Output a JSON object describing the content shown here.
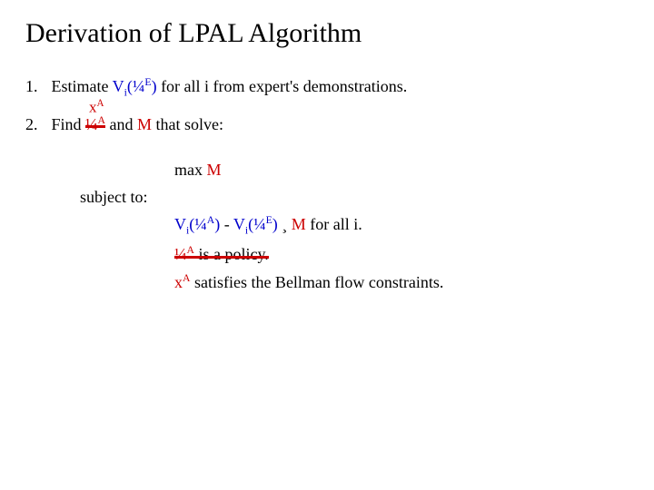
{
  "title": "Derivation of LPAL Algorithm",
  "step1": {
    "num": "1.",
    "pre": "Estimate ",
    "V": "V",
    "i": "i",
    "lp": "(",
    "pi": "¼",
    "E": "E",
    "rp": ")",
    "post": " for all i from expert's demonstrations."
  },
  "step2": {
    "num": "2.",
    "pre": "Find ",
    "piA_pi": "¼",
    "piA_A": "A",
    "and": " and ",
    "M": "M",
    "post": " that solve:",
    "xA_x": "x",
    "xA_A": "A"
  },
  "obj": {
    "max": "max ",
    "M": "M"
  },
  "subj": "subject to:",
  "c1": {
    "V1": "V",
    "i1": "i",
    "lp1": "(",
    "piA_pi": "¼",
    "piA_A": "A",
    "rp1": ")",
    "minus": " - ",
    "V2": "V",
    "i2": "i",
    "lp2": "(",
    "piE_pi": "¼",
    "piE_E": "E",
    "rp2": ")",
    "geq": " ¸ ",
    "M": "M",
    "forall": " for all i."
  },
  "c2": {
    "piA_pi": "¼",
    "piA_A": "A",
    "rest": " is a policy."
  },
  "c3": {
    "xA_x": "x",
    "xA_A": "A",
    "rest": " satisfies the Bellman flow constraints."
  }
}
